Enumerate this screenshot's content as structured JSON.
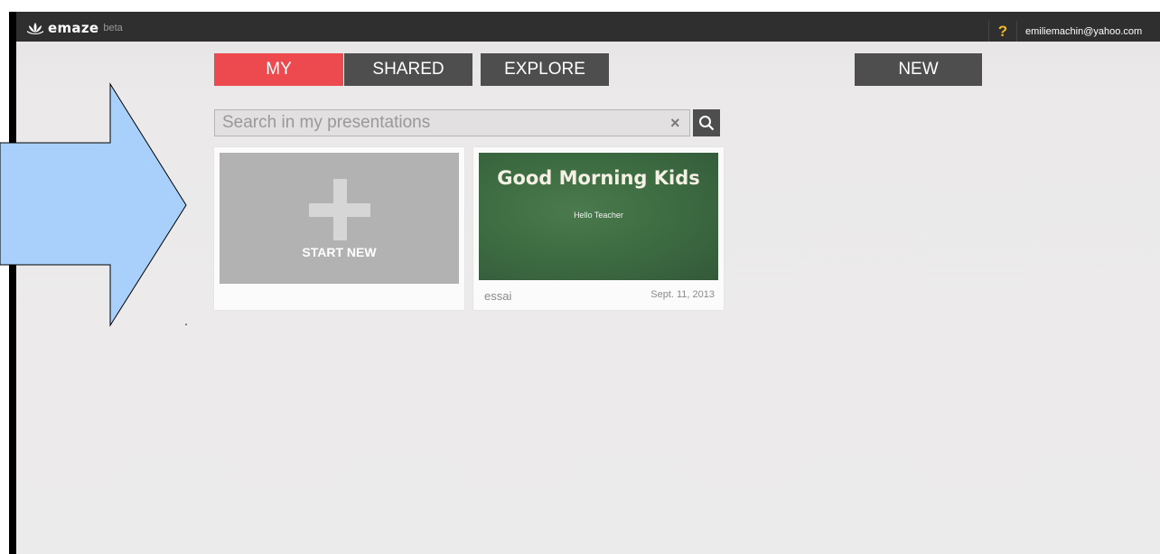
{
  "topbar": {
    "logo_text": "emaze",
    "logo_beta": "beta",
    "help_label": "?",
    "user_email": "emiliemachin@yahoo.com"
  },
  "tabs": [
    {
      "label": "MY",
      "active": true
    },
    {
      "label": "SHARED",
      "active": false
    },
    {
      "label": "EXPLORE",
      "active": false
    }
  ],
  "new_button": {
    "label": "NEW"
  },
  "search": {
    "placeholder": "Search in my presentations",
    "clear_label": "×"
  },
  "start_new": {
    "label": "START NEW"
  },
  "presentations": [
    {
      "thumb_title": "Good Morning Kids",
      "thumb_subtitle": "Hello Teacher",
      "name": "essai",
      "date": "Sept. 11, 2013"
    }
  ],
  "colors": {
    "topbar_bg": "#2f2f2f",
    "tab_active": "#ec4a4f",
    "tab_inactive": "#4e4e4e",
    "annotation_arrow": "#a8d0fa",
    "help_icon": "#f1b91e"
  }
}
